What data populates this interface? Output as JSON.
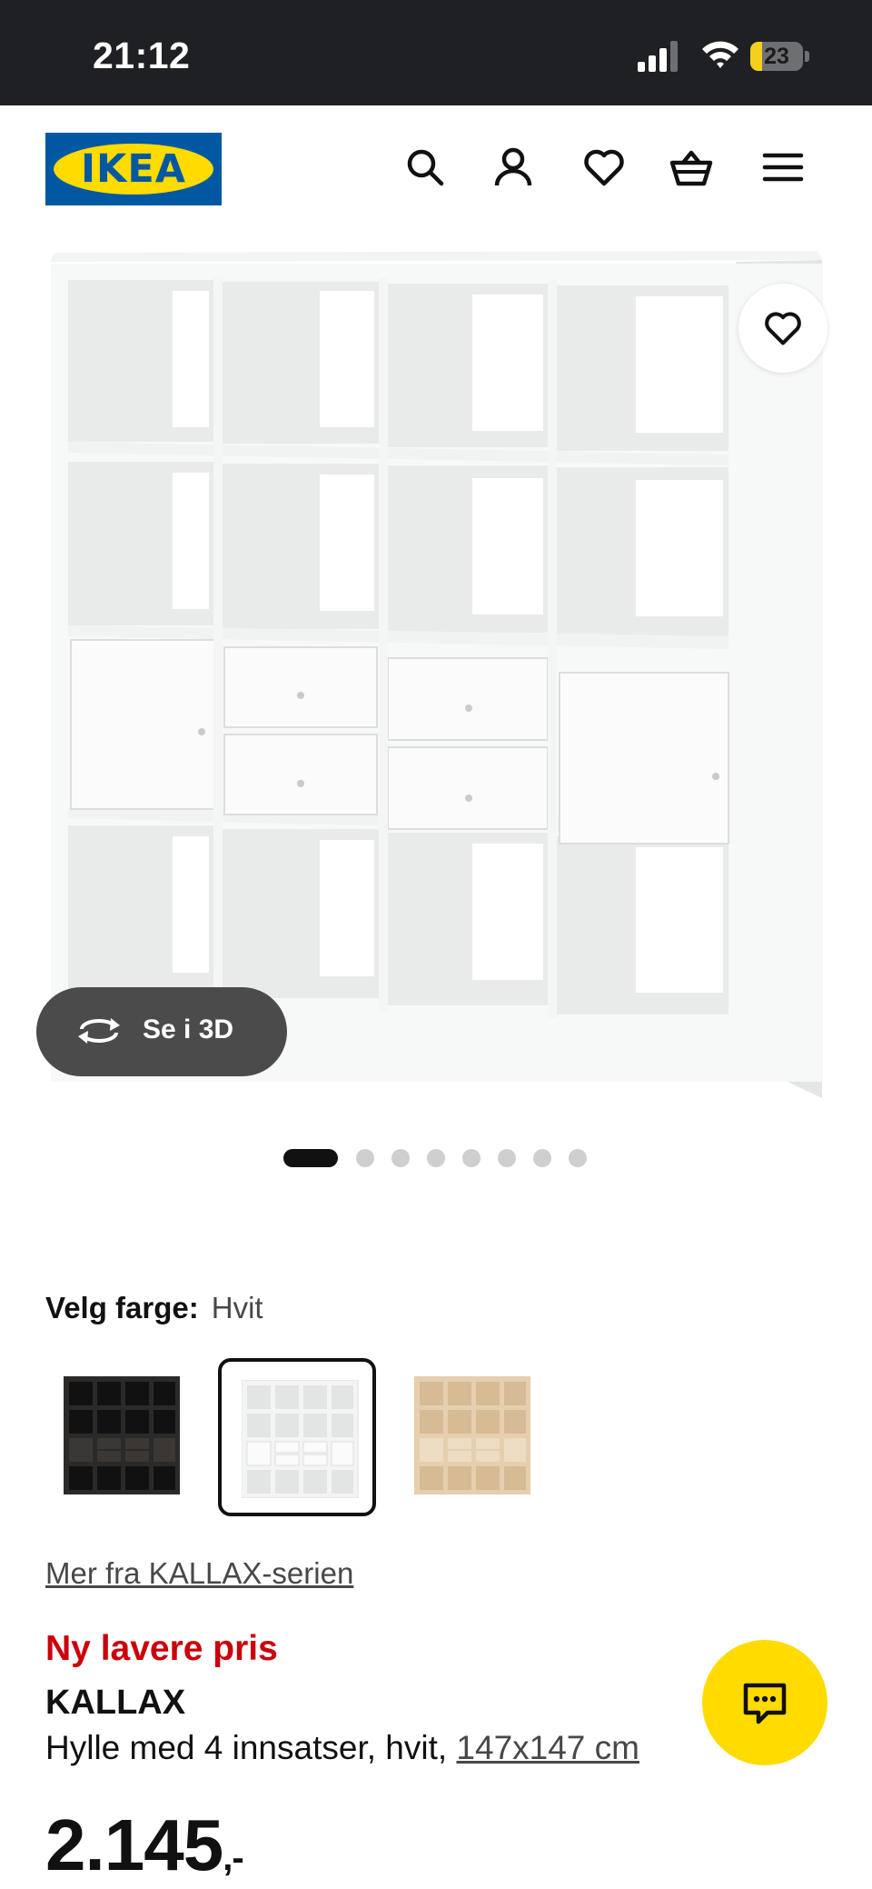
{
  "status_bar": {
    "time": "21:12",
    "battery": "23",
    "battery_level_percent": 23
  },
  "header": {
    "logo_text": "IKEA",
    "icons": [
      "search-icon",
      "account-icon",
      "favourites-icon",
      "basket-icon",
      "menu-icon"
    ]
  },
  "gallery": {
    "view_3d_label": "Se i 3D",
    "image_count": 8,
    "active_index": 0
  },
  "color_picker": {
    "label": "Velg farge:",
    "selected": "Hvit",
    "options": [
      "svart-brun",
      "hvit",
      "hvitlasert eikemønstret"
    ],
    "selected_index": 1
  },
  "series_link": "Mer fra KALLAX-serien",
  "product": {
    "badge": "Ny lavere pris",
    "name": "KALLAX",
    "description": "Hylle med 4 innsatser, hvit,",
    "size": "147x147 cm",
    "price": "2.145",
    "price_suffix": ",-"
  },
  "colors": {
    "ikea_blue": "#0058a3",
    "ikea_yellow": "#ffdb00",
    "price_red": "#cc0008",
    "status_bar": "#1f2024"
  }
}
